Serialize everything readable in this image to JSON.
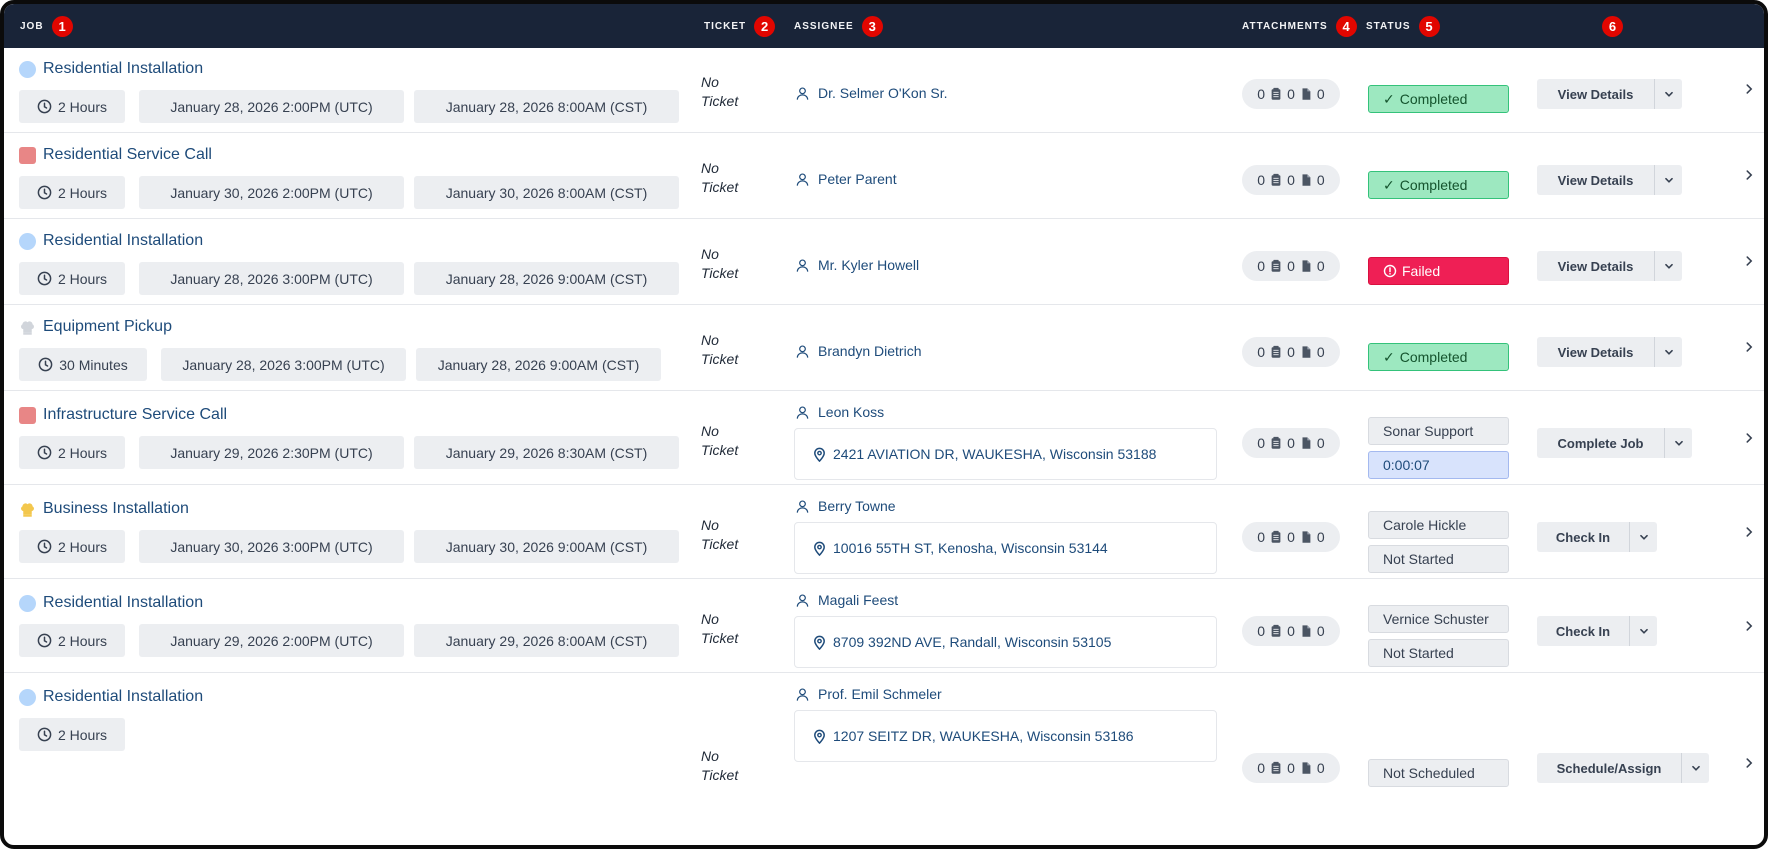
{
  "header": {
    "columns": [
      {
        "label": "JOB",
        "badge": "1"
      },
      {
        "label": "TICKET",
        "badge": "2"
      },
      {
        "label": "ASSIGNEE",
        "badge": "3"
      },
      {
        "label": "ATTACHMENTS",
        "badge": "4"
      },
      {
        "label": "STATUS",
        "badge": "5"
      },
      {
        "label": "",
        "badge": "6"
      }
    ]
  },
  "rows": [
    {
      "title": "Residential Installation",
      "icon": "blue-circle-icon",
      "duration": "2 Hours",
      "time_utc": "January 28, 2026 2:00PM (UTC)",
      "time_local": "January 28, 2026 8:00AM (CST)",
      "ticket_line1": "No",
      "ticket_line2": "Ticket",
      "assignee": "Dr. Selmer O'Kon Sr.",
      "address": "",
      "att_a": "0",
      "att_b": "0",
      "att_c": "0",
      "status": "Completed",
      "status_check": "✓",
      "status2": "",
      "action": "View Details"
    },
    {
      "title": "Residential Service Call",
      "icon": "red-square-icon",
      "duration": "2 Hours",
      "time_utc": "January 30, 2026 2:00PM (UTC)",
      "time_local": "January 30, 2026 8:00AM (CST)",
      "ticket_line1": "No",
      "ticket_line2": "Ticket",
      "assignee": "Peter Parent",
      "address": "",
      "att_a": "0",
      "att_b": "0",
      "att_c": "0",
      "status": "Completed",
      "status_check": "✓",
      "status2": "",
      "action": "View Details"
    },
    {
      "title": "Residential Installation",
      "icon": "blue-circle-icon",
      "duration": "2 Hours",
      "time_utc": "January 28, 2026 3:00PM (UTC)",
      "time_local": "January 28, 2026 9:00AM (CST)",
      "ticket_line1": "No",
      "ticket_line2": "Ticket",
      "assignee": "Mr. Kyler Howell",
      "address": "",
      "att_a": "0",
      "att_b": "0",
      "att_c": "0",
      "status": "Failed",
      "status2": "",
      "action": "View Details"
    },
    {
      "title": "Equipment Pickup",
      "icon": "gray-chef-hat-icon",
      "duration": "30 Minutes",
      "time_utc": "January 28, 2026 3:00PM (UTC)",
      "time_local": "January 28, 2026 9:00AM (CST)",
      "ticket_line1": "No",
      "ticket_line2": "Ticket",
      "assignee": "Brandyn Dietrich",
      "address": "",
      "att_a": "0",
      "att_b": "0",
      "att_c": "0",
      "status": "Completed",
      "status_check": "✓",
      "status2": "",
      "action": "View Details"
    },
    {
      "title": "Infrastructure Service Call",
      "icon": "red-square-icon",
      "duration": "2 Hours",
      "time_utc": "January 29, 2026 2:30PM (UTC)",
      "time_local": "January 29, 2026 8:30AM (CST)",
      "ticket_line1": "No",
      "ticket_line2": "Ticket",
      "assignee": "Leon Koss",
      "address": "2421 AVIATION DR, WAUKESHA, Wisconsin 53188",
      "att_a": "0",
      "att_b": "0",
      "att_c": "0",
      "status": "Sonar Support",
      "status2": "0:00:07",
      "action": "Complete Job"
    },
    {
      "title": "Business Installation",
      "icon": "yellow-chef-hat-icon",
      "duration": "2 Hours",
      "time_utc": "January 30, 2026 3:00PM (UTC)",
      "time_local": "January 30, 2026 9:00AM (CST)",
      "ticket_line1": "No",
      "ticket_line2": "Ticket",
      "assignee": "Berry Towne",
      "address": "10016 55TH ST, Kenosha, Wisconsin 53144",
      "att_a": "0",
      "att_b": "0",
      "att_c": "0",
      "status": "Carole Hickle",
      "status2": "Not Started",
      "action": "Check In"
    },
    {
      "title": "Residential Installation",
      "icon": "blue-circle-icon",
      "duration": "2 Hours",
      "time_utc": "January 29, 2026 2:00PM (UTC)",
      "time_local": "January 29, 2026 8:00AM (CST)",
      "ticket_line1": "No",
      "ticket_line2": "Ticket",
      "assignee": "Magali Feest",
      "address": "8709 392ND AVE, Randall, Wisconsin 53105",
      "att_a": "0",
      "att_b": "0",
      "att_c": "0",
      "status": "Vernice Schuster",
      "status2": "Not Started",
      "action": "Check In"
    },
    {
      "title": "Residential Installation",
      "icon": "blue-circle-icon",
      "duration": "2 Hours",
      "time_utc": "",
      "time_local": "",
      "ticket_line1": "No",
      "ticket_line2": "Ticket",
      "assignee": "Prof. Emil Schmeler",
      "address": "1207 SEITZ DR, WAUKESHA, Wisconsin 53186",
      "att_a": "0",
      "att_b": "0",
      "att_c": "0",
      "status": "Not Scheduled",
      "status2": "",
      "action": "Schedule/Assign"
    }
  ]
}
